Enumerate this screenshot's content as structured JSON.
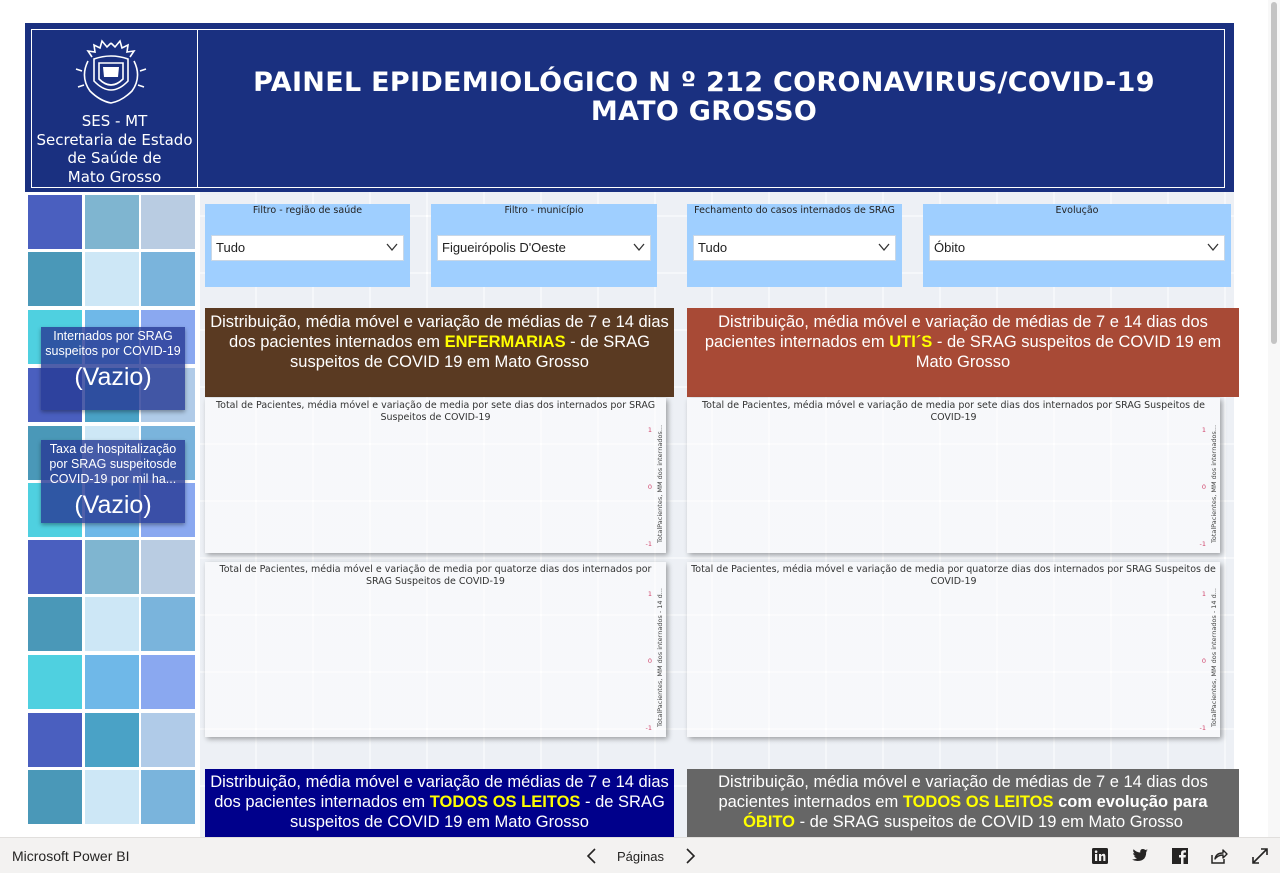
{
  "header": {
    "org_line1": "SES - MT",
    "org_line2": "Secretaria de Estado",
    "org_line3": "de Saúde de",
    "org_line4": "Mato Grosso",
    "title": "PAINEL EPIDEMIOLÓGICO N º 212 CORONAVIRUS/COVID-19 MATO GROSSO",
    "bg_color": "#1a3080"
  },
  "kpis": [
    {
      "label": "Internados por SRAG suspeitos por COVID-19",
      "value": "(Vazio)"
    },
    {
      "label": "Taxa de hospitalização por SRAG suspeitosde COVID-19 por mil ha...",
      "value": "(Vazio)"
    }
  ],
  "filters": [
    {
      "label": "Filtro - região de saúde",
      "value": "Tudo"
    },
    {
      "label": "Filtro - município",
      "value": "Figueirópolis D'Oeste"
    },
    {
      "label": "Fechamento do casos internados de SRAG",
      "value": "Tudo"
    },
    {
      "label": "Evolução",
      "value": "Óbito"
    }
  ],
  "sections": {
    "enfermarias": {
      "pre": "Distribuição, média móvel e variação de médias de 7 e  14 dias dos pacientes internados em ",
      "hl": "ENFERMARIAS",
      "post": "  - de SRAG suspeitos de COVID 19 em Mato Grosso",
      "color": "#5a3a22"
    },
    "utis": {
      "pre": "Distribuição, média móvel e variação de médias de 7 e  14 dias dos pacientes internados em ",
      "hl": "UTI´S",
      "post": "  - de SRAG suspeitos de COVID 19 em Mato Grosso",
      "color": "#a84a36"
    },
    "todos": {
      "pre": "Distribuição, média móvel e variação de médias de 7 e  14 dias dos pacientes  internados em ",
      "hl": "TODOS OS LEITOS",
      "post": "  - de SRAG suspeitos de COVID 19 em Mato Grosso",
      "color": "#00008b"
    },
    "obito": {
      "pre": "Distribuição, média móvel e variação de médias de 7 e  14 dias dos pacientes internados em ",
      "hl": "TODOS OS LEITOS",
      "mid": " com evolução para ",
      "hl2": "ÓBITO",
      "post": "  - de SRAG suspeitos de COVID 19 em Mato Grosso",
      "color": "#666666"
    }
  },
  "charts": {
    "enf7": {
      "title": "Total de Pacientes, média móvel e variação de media por sete dias dos internados por SRAG Suspeitos de COVID-19",
      "axis_label": "TotalPacientes, MM dos internados..."
    },
    "uti7": {
      "title": "Total de Pacientes, média móvel e variação de media por sete dias dos internados por SRAG Suspeitos de COVID-19",
      "axis_label": "TotalPacientes, MM dos internados..."
    },
    "enf14": {
      "title": "Total de Pacientes, média móvel e variação de media por quatorze dias dos internados por SRAG Suspeitos de COVID-19",
      "axis_label": "TotalPacientes, MM dos internados - 14 d..."
    },
    "uti14": {
      "title": "Total de Pacientes, média móvel e variação de media por quatorze dias dos internados por SRAG Suspeitos de COVID-19",
      "axis_label": "TotalPacientes, MM dos internados - 14 d..."
    },
    "ticks": [
      "1",
      "0",
      "-1"
    ]
  },
  "footer": {
    "brand": "Microsoft Power BI",
    "pages_label": "Páginas"
  }
}
